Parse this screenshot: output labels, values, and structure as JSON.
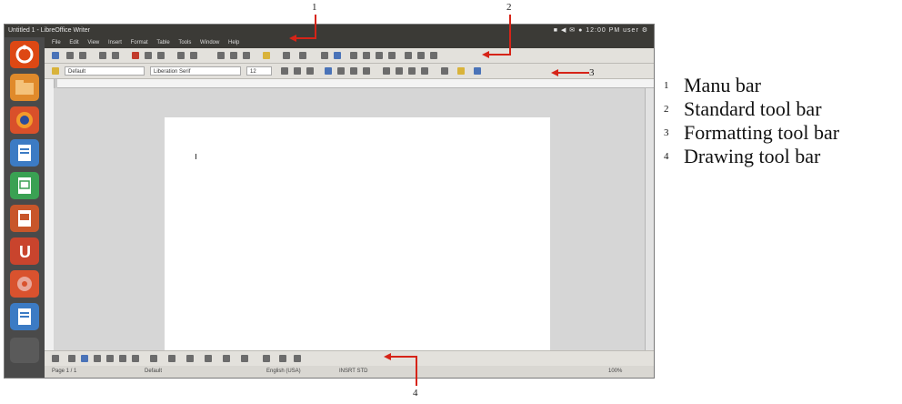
{
  "window": {
    "title": "Untitled 1 - LibreOffice Writer",
    "tray": "■ ◀ ✉ ● 12:00 PM  user ⚙"
  },
  "menu": {
    "items": [
      "File",
      "Edit",
      "View",
      "Insert",
      "Format",
      "Table",
      "Tools",
      "Window",
      "Help"
    ]
  },
  "formatting": {
    "style_value": "Default",
    "font_value": "Liberation Serif",
    "size_value": "12"
  },
  "status": {
    "page": "Page 1 / 1",
    "style": "Default",
    "language": "English (USA)",
    "mode": "INSRT  STD",
    "zoom": "100%"
  },
  "callouts": [
    "1",
    "2",
    "3",
    "4"
  ],
  "legend": [
    {
      "num": "1",
      "text": "Manu bar"
    },
    {
      "num": "2",
      "text": "Standard tool bar"
    },
    {
      "num": "3",
      "text": "Formatting tool bar"
    },
    {
      "num": "4",
      "text": "Drawing tool bar"
    }
  ],
  "colors": {
    "arrow": "#d62418",
    "launcher_ubuntu": "#dd4814",
    "launcher_files": "#e08a2b",
    "launcher_firefox": "#d9502a",
    "launcher_writer": "#3c7bc4",
    "launcher_calc": "#3aa153",
    "launcher_impress": "#c8562a",
    "launcher_ubuntuone": "#c9442d",
    "launcher_settings": "#d9522e",
    "launcher_writer2": "#3c7bc4"
  },
  "launcher_icons": [
    "ubuntu-logo-icon",
    "files-icon",
    "firefox-icon",
    "writer-icon",
    "calc-icon",
    "impress-icon",
    "ubuntu-one-icon",
    "settings-icon",
    "writer-icon"
  ]
}
